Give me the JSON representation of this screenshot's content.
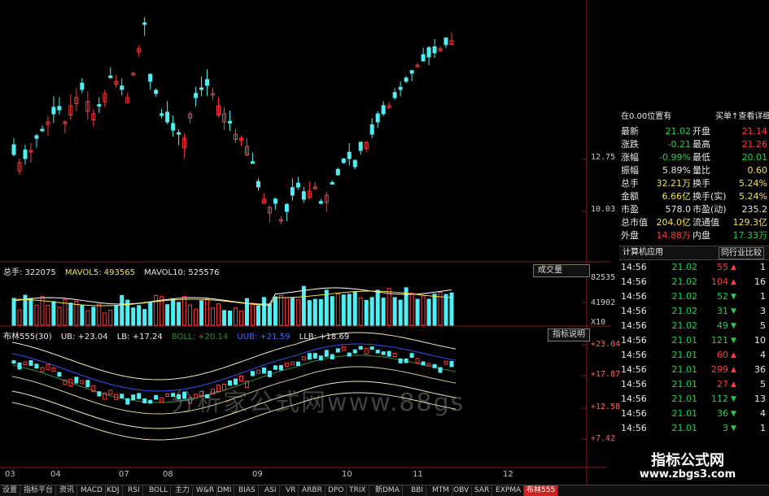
{
  "price_axis": {
    "main_labels": [
      "12.75",
      "10.03"
    ],
    "vol_labels": [
      "82535",
      "41902",
      "X10"
    ],
    "boll_labels": [
      "+23.04",
      "+17.87",
      "+12.58",
      "+7.42"
    ]
  },
  "vol_header": {
    "total": "总手: 322075",
    "mavol5": "MAVOL5: 493565",
    "mavol10": "MAVOL10: 525576",
    "button": "成交量"
  },
  "boll_header": {
    "name": "布林555(30)",
    "ub": "UB: +23.04",
    "lb": "LB: +17.24",
    "boll": "BOLL: +20.14",
    "uub": "UUB: +21.59",
    "llb": "LLB: +18.69",
    "button": "指标说明"
  },
  "dates": [
    "03",
    "04",
    "07",
    "08",
    "09",
    "10",
    "11",
    "12"
  ],
  "watermark_text": "分析家公式网www.88gs",
  "logo": {
    "title": "指标公式网",
    "url": "www.zbgs3.com"
  },
  "right_panel": {
    "top_left": "在0.00位置有",
    "top_right": "买单↑查看详细",
    "quotes": [
      {
        "l1": "最新",
        "v1": "21.02",
        "l2": "开盘",
        "v2": "21.14",
        "c1": "green",
        "c2": "red"
      },
      {
        "l1": "涨跌",
        "v1": "-0.21",
        "l2": "最高",
        "v2": "21.26",
        "c1": "green",
        "c2": "red"
      },
      {
        "l1": "涨幅",
        "v1": "-0.99%",
        "l2": "最低",
        "v2": "20.01",
        "c1": "green",
        "c2": "green"
      },
      {
        "l1": "振幅",
        "v1": "5.89%",
        "l2": "量比",
        "v2": "0.60",
        "c1": "white",
        "c2": "yellow"
      },
      {
        "l1": "总手",
        "v1": "32.21万",
        "l2": "换手",
        "v2": "5.24%",
        "c1": "yellow",
        "c2": "yellow"
      },
      {
        "l1": "金额",
        "v1": "6.66亿",
        "l2": "换手(实)",
        "v2": "5.24%",
        "c1": "yellow",
        "c2": "yellow"
      },
      {
        "l1": "市盈",
        "v1": "578.0",
        "l2": "市盈(动)",
        "v2": "235.2",
        "c1": "white",
        "c2": "white"
      },
      {
        "l1": "总市值",
        "v1": "204.0亿",
        "l2": "流通值",
        "v2": "129.3亿",
        "c1": "yellow",
        "c2": "yellow"
      },
      {
        "l1": "外盘",
        "v1": "14.88万",
        "l2": "内盘",
        "v2": "17.33万",
        "c1": "red",
        "c2": "green"
      }
    ],
    "industry_label": "计算机应用",
    "industry_button": "同行业比较",
    "ticks": [
      {
        "time": "14:56",
        "price": "21.02",
        "vol": "55",
        "dir": "up",
        "n": "1"
      },
      {
        "time": "14:56",
        "price": "21.02",
        "vol": "104",
        "dir": "up",
        "n": "16"
      },
      {
        "time": "14:56",
        "price": "21.02",
        "vol": "52",
        "dir": "down",
        "n": "1"
      },
      {
        "time": "14:56",
        "price": "21.02",
        "vol": "31",
        "dir": "down",
        "n": "3"
      },
      {
        "time": "14:56",
        "price": "21.02",
        "vol": "49",
        "dir": "down",
        "n": "5"
      },
      {
        "time": "14:56",
        "price": "21.01",
        "vol": "121",
        "dir": "down",
        "n": "10"
      },
      {
        "time": "14:56",
        "price": "21.01",
        "vol": "60",
        "dir": "up",
        "n": "4"
      },
      {
        "time": "14:56",
        "price": "21.01",
        "vol": "299",
        "dir": "up",
        "n": "36"
      },
      {
        "time": "14:56",
        "price": "21.01",
        "vol": "27",
        "dir": "up",
        "n": "5"
      },
      {
        "time": "14:56",
        "price": "21.01",
        "vol": "112",
        "dir": "down",
        "n": "13"
      },
      {
        "time": "14:56",
        "price": "21.01",
        "vol": "36",
        "dir": "down",
        "n": "4"
      },
      {
        "time": "14:56",
        "price": "21.01",
        "vol": "3",
        "dir": "down",
        "n": "1"
      }
    ]
  },
  "tabs": [
    "设置",
    "指标平台",
    "资讯",
    "MACD",
    "KDJ",
    "RSI",
    "BOLL",
    "主力",
    "W&R",
    "DMI",
    "BIAS",
    "ASI",
    "VR",
    "ARBR",
    "DPO",
    "TRIX",
    "新DMA",
    "BBI",
    "MTM",
    "OBV",
    "SAR",
    "EXPMA",
    "布林555"
  ],
  "active_tab": "布林555",
  "colors": {
    "up": "#ff3b3b",
    "down": "#4ef0f5",
    "boll_mid": "#3050ff",
    "band": "#e8e0a0"
  }
}
